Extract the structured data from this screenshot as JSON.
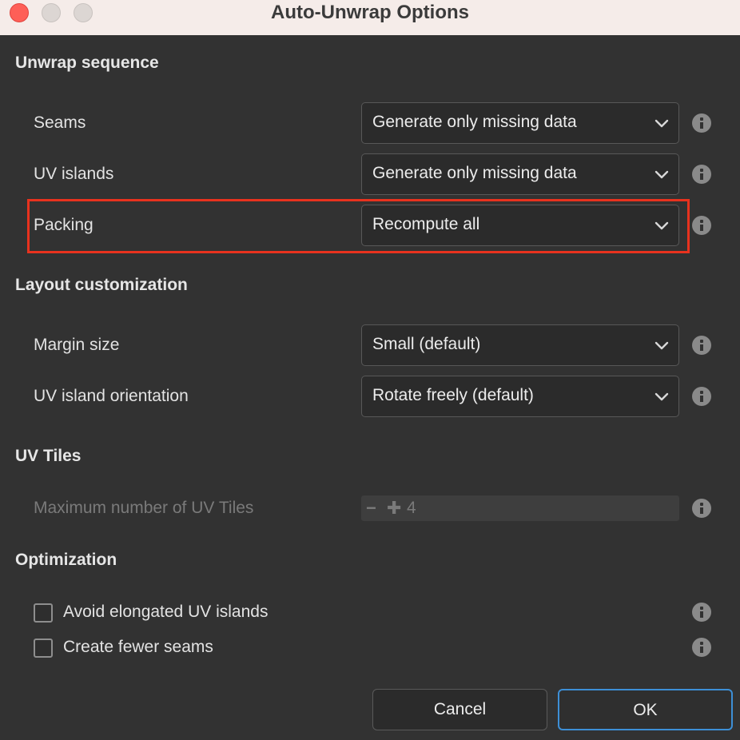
{
  "window": {
    "title": "Auto-Unwrap Options"
  },
  "sections": {
    "unwrap": "Unwrap sequence",
    "layout": "Layout customization",
    "tiles": "UV Tiles",
    "optimization": "Optimization"
  },
  "rows": {
    "seams": {
      "label": "Seams",
      "value": "Generate only missing data"
    },
    "uv_islands": {
      "label": "UV islands",
      "value": "Generate only missing data"
    },
    "packing": {
      "label": "Packing",
      "value": "Recompute all"
    },
    "margin_size": {
      "label": "Margin size",
      "value": "Small (default)"
    },
    "uv_orientation": {
      "label": "UV island orientation",
      "value": "Rotate freely (default)"
    },
    "max_uv_tiles": {
      "label": "Maximum number of UV Tiles",
      "value": "4",
      "minus": "−",
      "plus": "✚"
    }
  },
  "checkboxes": {
    "avoid_elongated": {
      "label": "Avoid elongated UV islands",
      "checked": false
    },
    "fewer_seams": {
      "label": "Create fewer seams",
      "checked": false
    }
  },
  "buttons": {
    "cancel": "Cancel",
    "ok": "OK"
  },
  "icons": [
    "close-icon",
    "minimize-icon",
    "maximize-icon",
    "chevron-down-icon",
    "info-icon"
  ],
  "colors": {
    "highlight": "#e8321e",
    "ok_border": "#3d8fd6",
    "background": "#323232"
  }
}
